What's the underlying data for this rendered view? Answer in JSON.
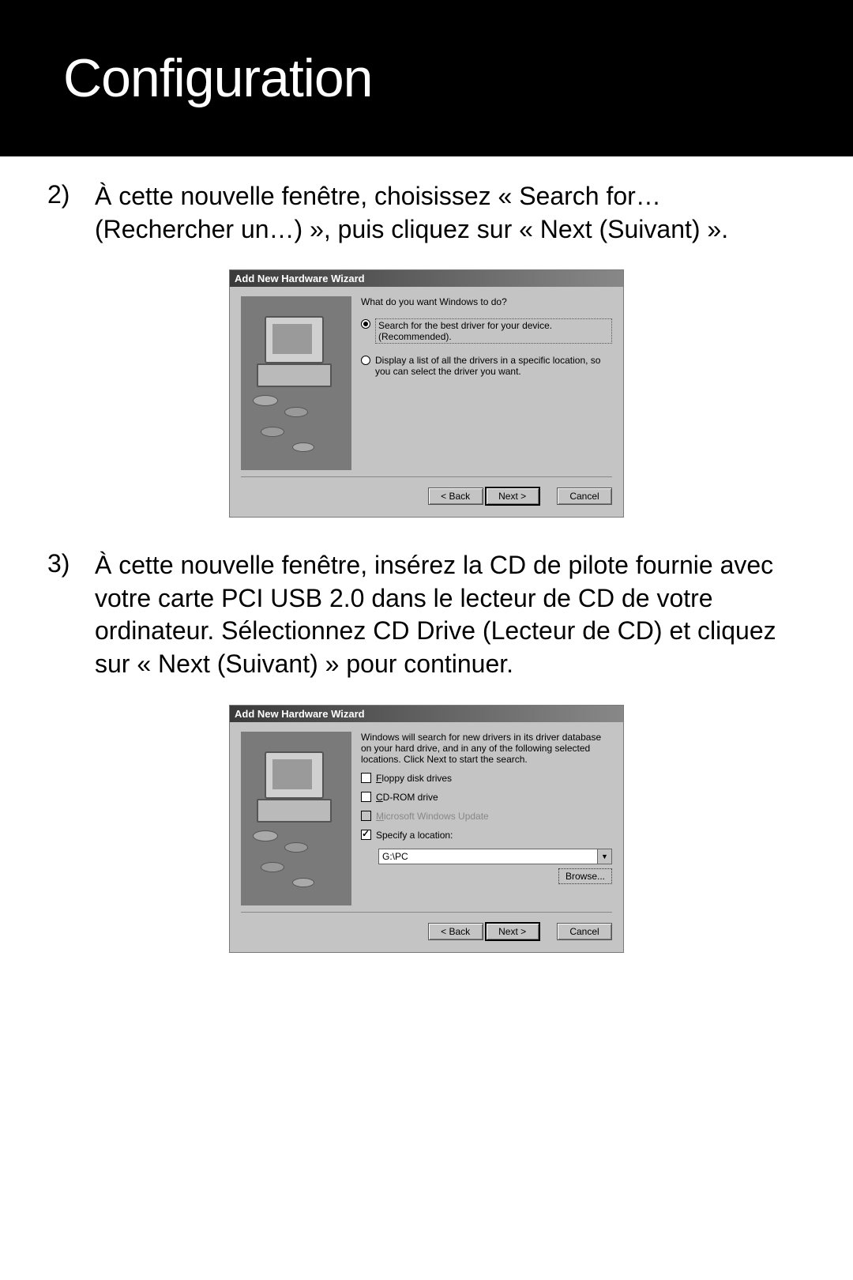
{
  "header": {
    "title": "Configuration"
  },
  "steps": {
    "s2": {
      "num": "2)",
      "text": "À cette nouvelle fenêtre, choisissez « Search for… (Rechercher un…) », puis cliquez sur « Next (Suivant) »."
    },
    "s3": {
      "num": "3)",
      "text": "À cette nouvelle fenêtre, insérez la CD de pilote fournie avec votre carte PCI USB 2.0 dans le lecteur de CD de votre ordinateur. Sélectionnez CD Drive (Lecteur de CD) et cliquez sur « Next (Suivant) » pour continuer."
    }
  },
  "wiz1": {
    "title": "Add New Hardware Wizard",
    "question": "What do you want Windows to do?",
    "opt1": "Search for the best driver for your device. (Recommended).",
    "opt2": "Display a list of all the drivers in a specific location, so you can select the driver you want.",
    "back": "< Back",
    "next": "Next >",
    "cancel": "Cancel"
  },
  "wiz2": {
    "title": "Add New Hardware Wizard",
    "intro": "Windows will search for new drivers in its driver database on your hard drive, and in any of the following selected locations. Click Next to start the search.",
    "floppy": "Floppy disk drives",
    "cdrom": "CD-ROM drive",
    "msupdate": "Microsoft Windows Update",
    "specify": "Specify a location:",
    "path": "G:\\PC",
    "browse": "Browse...",
    "back": "< Back",
    "next": "Next >",
    "cancel": "Cancel"
  }
}
